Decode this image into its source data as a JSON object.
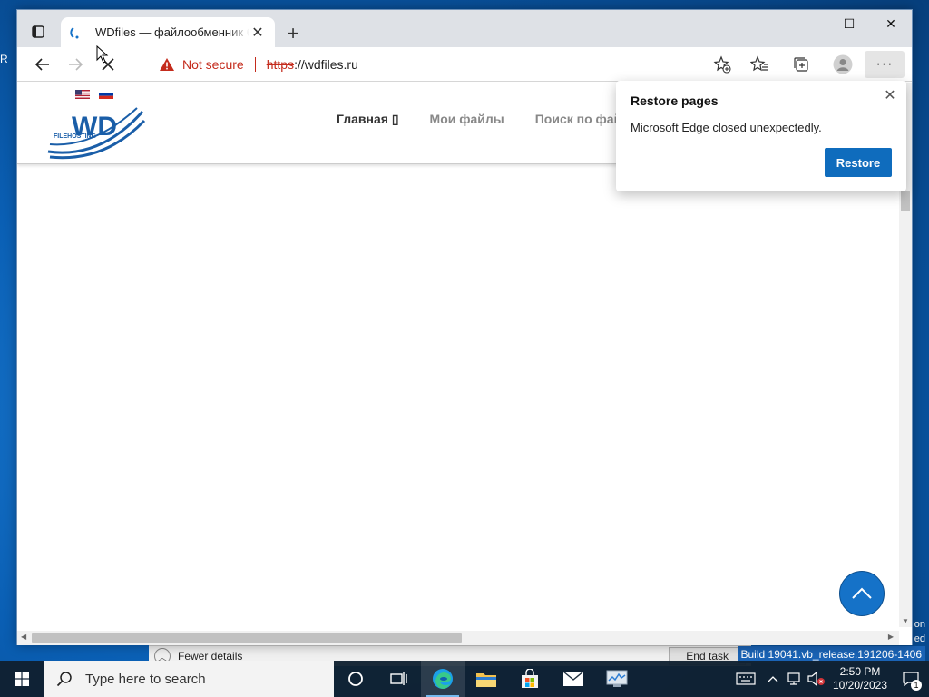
{
  "window": {
    "tab_title": "WDfiles — файлообменник бесплатный",
    "controls": {
      "minimize": "—",
      "maximize": "☐",
      "close": "✕"
    }
  },
  "toolbar": {
    "security_label": "Not secure",
    "url_scheme": "https",
    "url_rest": "://wdfiles.ru",
    "more_label": "···"
  },
  "site": {
    "logo_text": "WD",
    "logo_subtext": "FILEHOSTING",
    "nav": [
      {
        "label": "Главная ▯"
      },
      {
        "label": "Мои файлы"
      },
      {
        "label": "Поиск по файлам"
      }
    ]
  },
  "popup": {
    "title": "Restore pages",
    "message": "Microsoft Edge closed unexpectedly.",
    "restore_label": "Restore"
  },
  "background": {
    "left_edge_char": "R",
    "fewer_details": "Fewer details",
    "end_task": "End task",
    "build": "Build 19041.vb_release.191206-1406",
    "right_edge_lines": [
      "on",
      "ed"
    ]
  },
  "taskbar": {
    "search_placeholder": "Type here to search",
    "time": "2:50 PM",
    "date": "10/20/2023",
    "notification_count": "1"
  },
  "colors": {
    "accent": "#0f6cbd",
    "danger": "#c42b1c",
    "scroll_top": "#1572c8"
  }
}
